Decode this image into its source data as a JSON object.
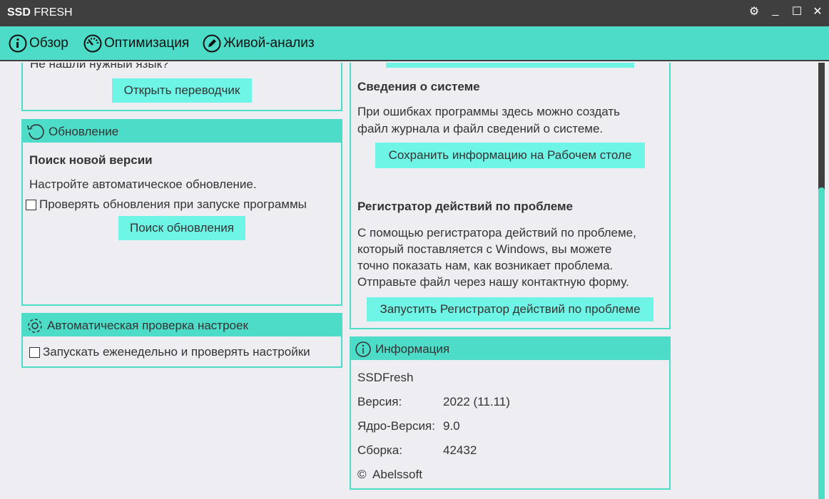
{
  "window": {
    "title_bold": "SSD",
    "title_rest": "FRESH"
  },
  "nav": [
    "Обзор",
    "Оптимизация",
    "Живой-анализ"
  ],
  "language": {
    "text": "Не нашли нужный язык?",
    "button": "Открыть переводчик"
  },
  "update": {
    "header": "Обновление",
    "heading": "Поиск новой версии",
    "desc": "Настройте автоматическое обновление.",
    "checkbox": "Проверять обновления при запуске программы",
    "button": "Поиск обновления"
  },
  "autocheck": {
    "header": "Автоматическая проверка настроек",
    "checkbox": "Запускать еженедельно и проверять настройки"
  },
  "support": {
    "sysinfo_heading": "Сведения о системе",
    "sysinfo_lines": [
      "При ошибках программы здесь можно создать",
      "файл журнала и файл сведений о системе."
    ],
    "sysinfo_button": "Сохранить информацию на Рабочем столе",
    "recorder_heading": "Регистратор действий по проблеме",
    "recorder_lines": [
      "С помощью регистратора  действий по проблеме,",
      "который поставляется с Windows, вы можете",
      "точно показать нам, как возникает проблема.",
      "Отправьте файл через нашу контактную форму."
    ],
    "recorder_button": "Запустить Регистратор действий по проблеме"
  },
  "info": {
    "header": "Информация",
    "product": "SSDFresh",
    "rows": [
      {
        "label": "Версия:",
        "value": "2022 (11.11)"
      },
      {
        "label": "Ядро-Версия:",
        "value": "9.0"
      },
      {
        "label": "Сборка:",
        "value": "42432"
      }
    ],
    "copyright": "©  Abelssoft"
  }
}
